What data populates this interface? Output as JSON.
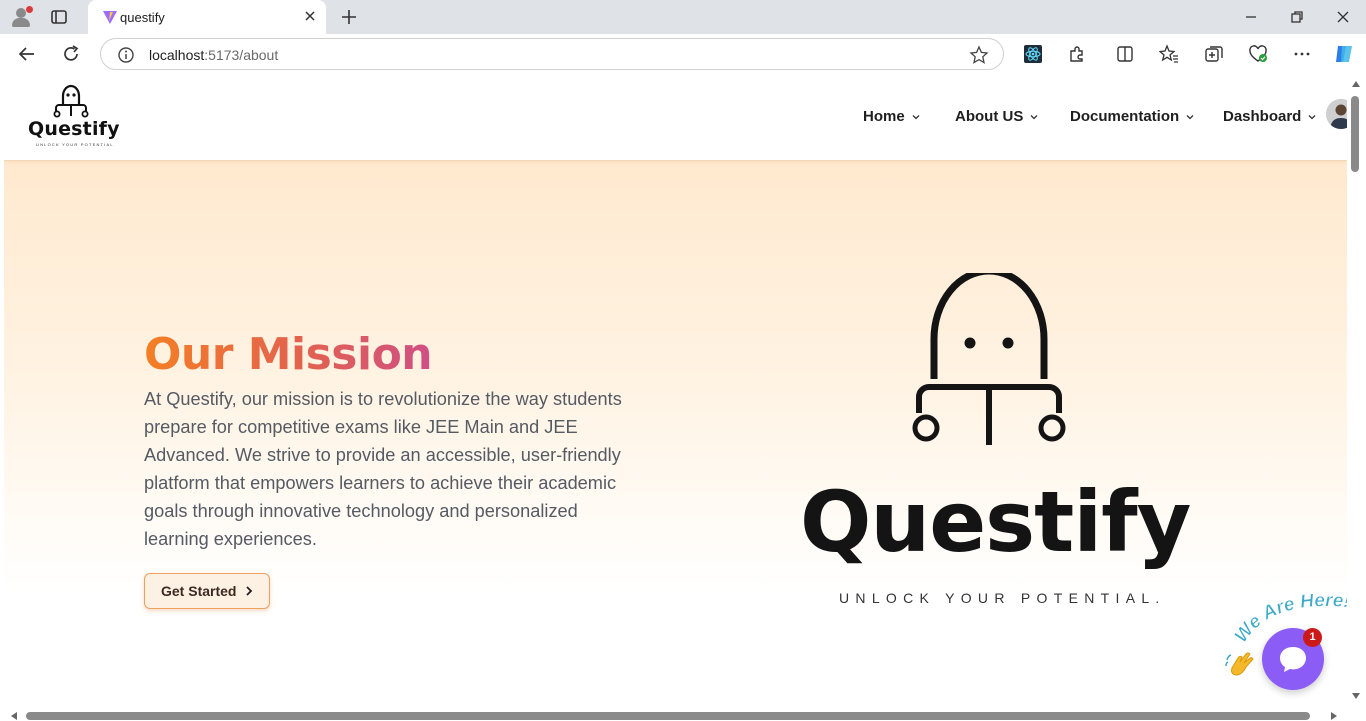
{
  "browser": {
    "tab_title": "questify",
    "url_host": "localhost",
    "url_rest": ":5173/about"
  },
  "site": {
    "logo_word": "Questify",
    "logo_tagline": "UNLOCK YOUR POTENTIAL",
    "nav": [
      {
        "label": "Home"
      },
      {
        "label": "About US"
      },
      {
        "label": "Documentation"
      },
      {
        "label": "Dashboard"
      }
    ]
  },
  "hero": {
    "title": "Our Mission",
    "body": "At Questify, our mission is to revolutionize the way students prepare for competitive exams like JEE Main and JEE Advanced. We strive to provide an accessible, user-friendly platform that empowers learners to achieve their academic goals through innovative technology and personalized learning experiences.",
    "cta_label": "Get Started",
    "brand_word": "Questify",
    "brand_tagline": "UNLOCK YOUR POTENTIAL."
  },
  "chat": {
    "badge_text": "We Are Here!",
    "count": "1"
  },
  "colors": {
    "title_gradient_start": "#f47f24",
    "title_gradient_end": "#cf4f86",
    "chat_purple": "#8b5cf6",
    "hero_peach": "#ffe9cf"
  }
}
